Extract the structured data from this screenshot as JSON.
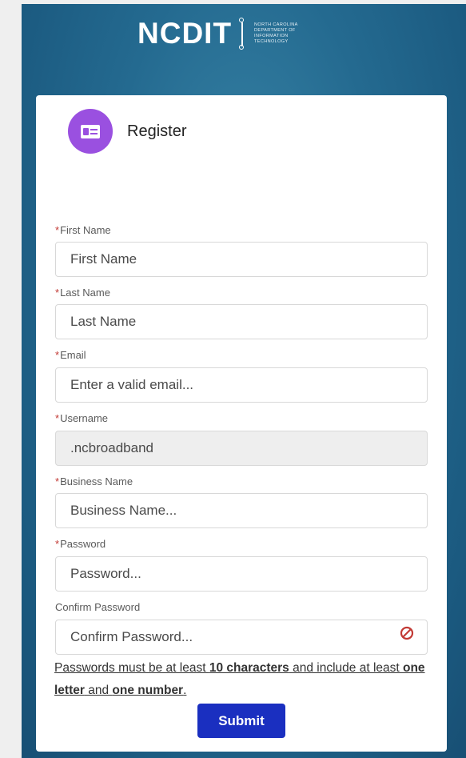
{
  "header": {
    "logo_text": "NCDIT",
    "logo_subtitle": [
      "NORTH CAROLINA",
      "DEPARTMENT OF",
      "INFORMATION",
      "TECHNOLOGY"
    ]
  },
  "form": {
    "title": "Register",
    "icon": "contact-card-icon",
    "required_marker": "*",
    "fields": {
      "first_name": {
        "label": "First Name",
        "required": true,
        "placeholder": "First Name",
        "value": ""
      },
      "last_name": {
        "label": "Last Name",
        "required": true,
        "placeholder": "Last Name",
        "value": ""
      },
      "email": {
        "label": "Email",
        "required": true,
        "placeholder": "Enter a valid email...",
        "value": ""
      },
      "username": {
        "label": "Username",
        "required": true,
        "placeholder": "",
        "value": ".ncbroadband",
        "readonly": true
      },
      "business_name": {
        "label": "Business Name",
        "required": true,
        "placeholder": "Business Name...",
        "value": ""
      },
      "password": {
        "label": "Password",
        "required": true,
        "placeholder": "Password...",
        "value": ""
      },
      "confirm_password": {
        "label": "Confirm Password",
        "required": false,
        "placeholder": "Confirm Password...",
        "value": "",
        "error_icon": "blocked-icon"
      }
    },
    "password_note": {
      "part1": "Passwords must be at least ",
      "bold1": "10 characters",
      "part2": " and include at least ",
      "bold2": "one letter",
      "part3": " and ",
      "bold3": "one number",
      "part4": "."
    },
    "submit_label": "Submit"
  },
  "colors": {
    "background_blue": "#246a90",
    "icon_purple": "#9a50e0",
    "submit_blue": "#1a2fc0",
    "required_red": "#c23934",
    "error_red": "#c23934"
  }
}
